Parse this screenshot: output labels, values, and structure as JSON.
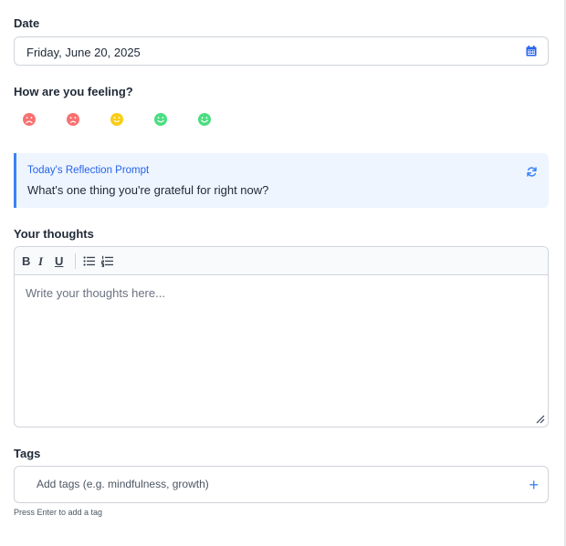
{
  "date": {
    "label": "Date",
    "value": "Friday, June 20, 2025",
    "icon": "calendar-icon"
  },
  "mood": {
    "label": "How are you feeling?",
    "options": [
      {
        "name": "very-sad-icon",
        "color": "#f87171"
      },
      {
        "name": "sad-icon",
        "color": "#f87171"
      },
      {
        "name": "neutral-icon",
        "color": "#facc15"
      },
      {
        "name": "happy-icon",
        "color": "#4ade80"
      },
      {
        "name": "very-happy-icon",
        "color": "#4ade80"
      }
    ]
  },
  "prompt": {
    "title": "Today's Reflection Prompt",
    "text": "What's one thing you're grateful for right now?",
    "icon": "refresh-icon"
  },
  "thoughts": {
    "label": "Your thoughts",
    "placeholder": "Write your thoughts here...",
    "toolbar": {
      "bold": "B",
      "italic": "I",
      "underline": "U",
      "bullet_list_icon": "bullet-list-icon",
      "numbered_list_icon": "numbered-list-icon"
    }
  },
  "tags": {
    "label": "Tags",
    "placeholder": "Add tags (e.g. mindfulness, growth)",
    "add": "+",
    "hint": "Press Enter to add a tag"
  },
  "colors": {
    "accent": "#3b82f6",
    "prompt_bg": "#eef5ff",
    "sad": "#f87171",
    "neutral": "#facc15",
    "happy": "#4ade80"
  }
}
